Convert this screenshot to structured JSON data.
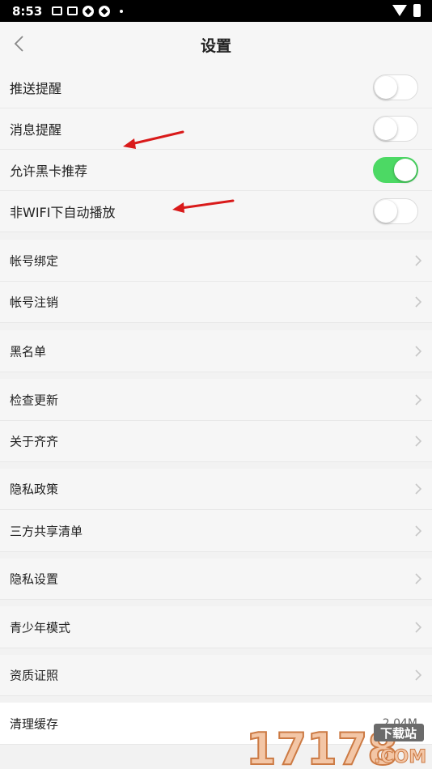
{
  "status_bar": {
    "time": "8:53"
  },
  "header": {
    "title": "设置"
  },
  "toggles": [
    {
      "label": "推送提醒",
      "on": false
    },
    {
      "label": "消息提醒",
      "on": false
    },
    {
      "label": "允许黑卡推荐",
      "on": true
    },
    {
      "label": "非WIFI下自动播放",
      "on": false
    }
  ],
  "menu": [
    {
      "label": "帐号绑定"
    },
    {
      "label": "帐号注销"
    },
    {
      "label": "黑名单"
    },
    {
      "label": "检查更新"
    },
    {
      "label": "关于齐齐"
    },
    {
      "label": "隐私政策"
    },
    {
      "label": "三方共享清单"
    },
    {
      "label": "隐私设置"
    },
    {
      "label": "青少年模式"
    },
    {
      "label": "资质证照"
    }
  ],
  "cache": {
    "label": "清理缓存",
    "value": "2.04M"
  },
  "watermark": {
    "text": "17178",
    "badge": "下载站",
    "domain": ".COM"
  },
  "colors": {
    "toggle_on": "#4cd964",
    "annotation_arrow": "#d91a1a"
  }
}
